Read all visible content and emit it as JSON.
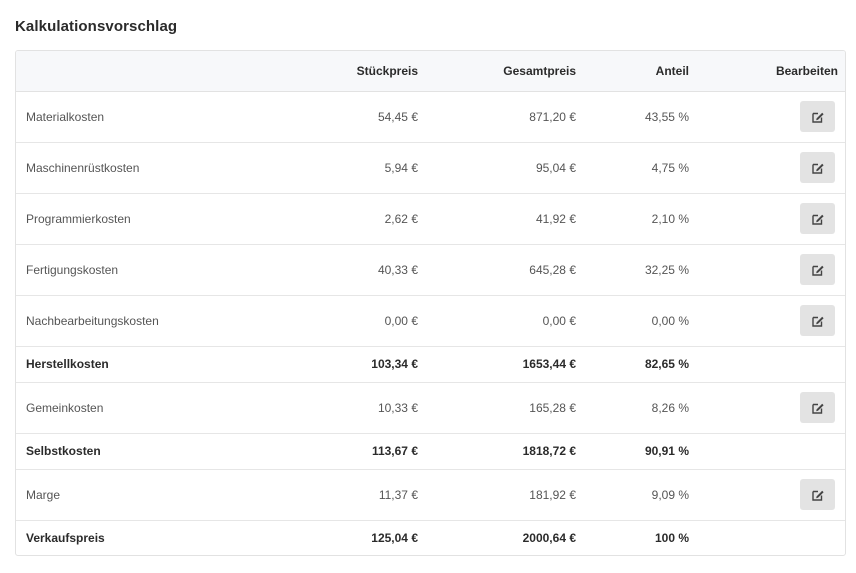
{
  "page": {
    "title": "Kalkulationsvorschlag"
  },
  "table": {
    "headers": {
      "name": "",
      "unit_price": "Stückpreis",
      "total_price": "Gesamtpreis",
      "share": "Anteil",
      "edit": "Bearbeiten"
    },
    "rows": [
      {
        "name": "Materialkosten",
        "unit_price": "54,45 €",
        "total_price": "871,20 €",
        "share": "43,55 %",
        "editable": true,
        "edit_icon": "edit-icon"
      },
      {
        "name": "Maschinenrüstkosten",
        "unit_price": "5,94 €",
        "total_price": "95,04 €",
        "share": "4,75 %",
        "editable": true,
        "edit_icon": "edit-icon"
      },
      {
        "name": "Programmierkosten",
        "unit_price": "2,62 €",
        "total_price": "41,92 €",
        "share": "2,10 %",
        "editable": true,
        "edit_icon": "edit-icon"
      },
      {
        "name": "Fertigungskosten",
        "unit_price": "40,33 €",
        "total_price": "645,28 €",
        "share": "32,25 %",
        "editable": true,
        "edit_icon": "edit-icon"
      },
      {
        "name": "Nachbearbeitungskosten",
        "unit_price": "0,00 €",
        "total_price": "0,00 €",
        "share": "0,00 %",
        "editable": true,
        "edit_icon": "edit-icon"
      },
      {
        "name": "Herstellkosten",
        "unit_price": "103,34 €",
        "total_price": "1653,44 €",
        "share": "82,65 %",
        "editable": false
      },
      {
        "name": "Gemeinkosten",
        "unit_price": "10,33 €",
        "total_price": "165,28 €",
        "share": "8,26 %",
        "editable": true,
        "edit_icon": "edit-icon"
      },
      {
        "name": "Selbstkosten",
        "unit_price": "113,67 €",
        "total_price": "1818,72 €",
        "share": "90,91 %",
        "editable": false
      },
      {
        "name": "Marge",
        "unit_price": "11,37 €",
        "total_price": "181,92 €",
        "share": "9,09 %",
        "editable": true,
        "edit_icon": "edit-icon"
      },
      {
        "name": "Verkaufspreis",
        "unit_price": "125,04 €",
        "total_price": "2000,64 €",
        "share": "100 %",
        "editable": false
      }
    ]
  },
  "colors": {
    "edit_button_bg": "#e3e3e3",
    "header_bg": "#f7f8fa",
    "border": "#e2e2e2"
  }
}
